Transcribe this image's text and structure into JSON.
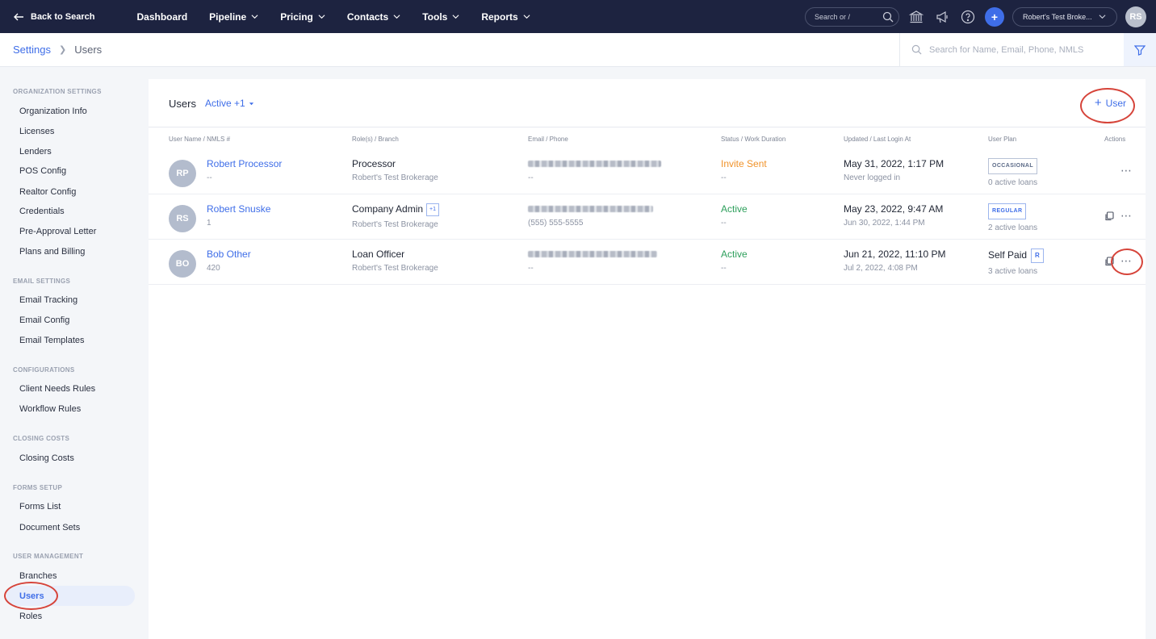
{
  "topnav": {
    "back_label": "Back to Search",
    "menu": [
      {
        "label": "Dashboard",
        "has_chevron": false
      },
      {
        "label": "Pipeline",
        "has_chevron": true
      },
      {
        "label": "Pricing",
        "has_chevron": true
      },
      {
        "label": "Contacts",
        "has_chevron": true
      },
      {
        "label": "Tools",
        "has_chevron": true
      },
      {
        "label": "Reports",
        "has_chevron": true
      }
    ],
    "search_placeholder": "Search or /",
    "org_name": "Robert's Test Broke...",
    "avatar_initials": "RS",
    "icons": [
      "bank-icon",
      "megaphone-icon",
      "help-icon",
      "plus-icon"
    ]
  },
  "breadcrumb": {
    "parent": "Settings",
    "current": "Users"
  },
  "filter_search_placeholder": "Search for Name, Email, Phone, NMLS",
  "sidebar": {
    "groups": [
      {
        "title": "ORGANIZATION SETTINGS",
        "items": [
          "Organization Info",
          "Licenses",
          "Lenders",
          "POS Config",
          "Realtor Config",
          "Credentials",
          "Pre-Approval Letter",
          "Plans and Billing"
        ]
      },
      {
        "title": "EMAIL SETTINGS",
        "items": [
          "Email Tracking",
          "Email Config",
          "Email Templates"
        ]
      },
      {
        "title": "CONFIGURATIONS",
        "items": [
          "Client Needs Rules",
          "Workflow Rules"
        ]
      },
      {
        "title": "CLOSING COSTS",
        "items": [
          "Closing Costs"
        ]
      },
      {
        "title": "FORMS SETUP",
        "items": [
          "Forms List",
          "Document Sets"
        ]
      },
      {
        "title": "USER MANAGEMENT",
        "items": [
          "Branches",
          "Users",
          "Roles"
        ]
      }
    ],
    "active_item": "Users"
  },
  "main": {
    "title": "Users",
    "filter_label": "Active +1",
    "add_label": "User",
    "columns": [
      "User Name / NMLS #",
      "Role(s) / Branch",
      "Email / Phone",
      "Status / Work Duration",
      "Updated / Last Login At",
      "User Plan",
      "Actions"
    ],
    "rows": [
      {
        "initials": "RP",
        "name": "Robert Processor",
        "nmls": "--",
        "role": "Processor",
        "role_extra": "",
        "branch": "Robert's Test Brokerage",
        "phone": "--",
        "status": "Invite Sent",
        "status_kind": "invite",
        "duration": "--",
        "updated": "May 31, 2022, 1:17 PM",
        "last_login": "Never logged in",
        "plan": "OCCASIONAL",
        "plan_kind": "badge-gray",
        "loans": "0 active loans",
        "show_copy": false
      },
      {
        "initials": "RS",
        "name": "Robert Snuske",
        "nmls": "1",
        "role": "Company Admin",
        "role_extra": "+1",
        "branch": "Robert's Test Brokerage",
        "phone": "(555) 555-5555",
        "status": "Active",
        "status_kind": "active",
        "duration": "--",
        "updated": "May 23, 2022, 9:47 AM",
        "last_login": "Jun 30, 2022, 1:44 PM",
        "plan": "REGULAR",
        "plan_kind": "badge-blue",
        "loans": "2 active loans",
        "show_copy": true
      },
      {
        "initials": "BO",
        "name": "Bob Other",
        "nmls": "420",
        "role": "Loan Officer",
        "role_extra": "",
        "branch": "Robert's Test Brokerage",
        "phone": "--",
        "status": "Active",
        "status_kind": "active",
        "duration": "--",
        "updated": "Jun 21, 2022, 11:10 PM",
        "last_login": "Jul 2, 2022, 4:08 PM",
        "plan": "Self Paid",
        "plan_kind": "text-r",
        "plan_suffix": "R",
        "loans": "3 active loans",
        "show_copy": true
      }
    ]
  },
  "colors": {
    "nav_bg": "#1d2340",
    "accent": "#3f6ee8",
    "invite": "#f0932b",
    "active": "#2d9f5b",
    "annotation": "#d6443a"
  }
}
